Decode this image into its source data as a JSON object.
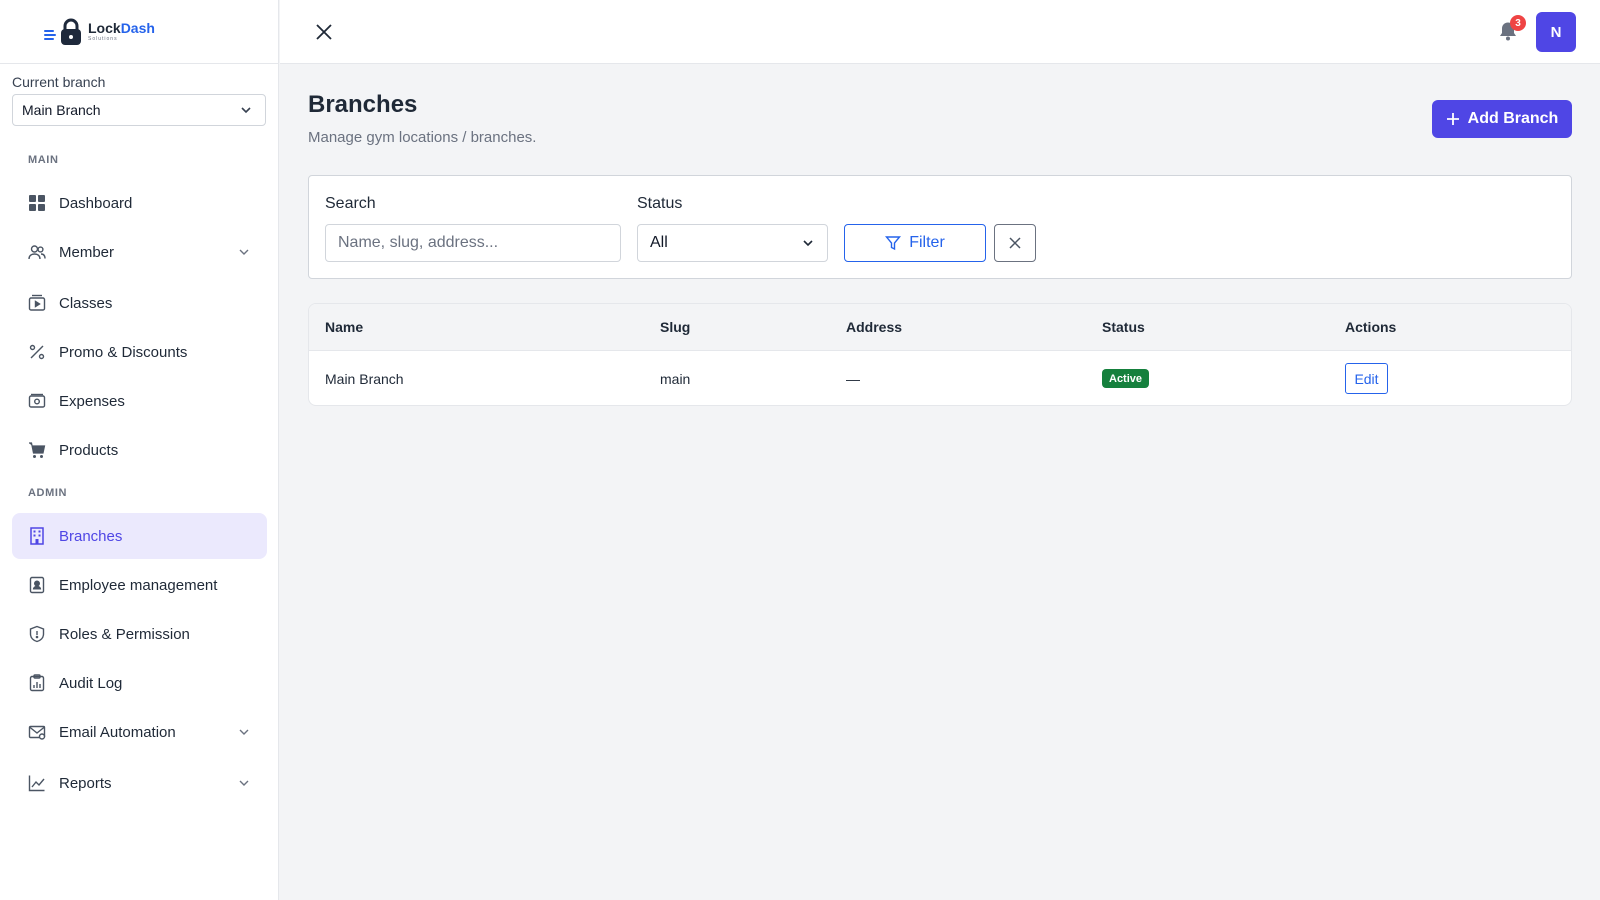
{
  "app": {
    "logo_name_part1": "Lock",
    "logo_name_part2": "Dash",
    "logo_subtitle": "Solutions"
  },
  "sidebar": {
    "branch_label": "Current branch",
    "branch_value": "Main Branch",
    "sections": {
      "main": "MAIN",
      "admin": "ADMIN"
    },
    "items": [
      {
        "label": "Dashboard",
        "icon": "grid-icon"
      },
      {
        "label": "Member",
        "icon": "users-icon",
        "expandable": true
      },
      {
        "label": "Classes",
        "icon": "video-icon"
      },
      {
        "label": "Promo & Discounts",
        "icon": "percent-icon"
      },
      {
        "label": "Expenses",
        "icon": "wallet-icon"
      },
      {
        "label": "Products",
        "icon": "cart-icon"
      },
      {
        "label": "Branches",
        "icon": "building-icon",
        "active": true
      },
      {
        "label": "Employee management",
        "icon": "id-badge-icon"
      },
      {
        "label": "Roles & Permission",
        "icon": "shield-icon"
      },
      {
        "label": "Audit Log",
        "icon": "clipboard-chart-icon"
      },
      {
        "label": "Email Automation",
        "icon": "mail-icon",
        "expandable": true
      },
      {
        "label": "Reports",
        "icon": "line-chart-icon",
        "expandable": true
      }
    ]
  },
  "topbar": {
    "notification_count": "3",
    "avatar_initial": "N"
  },
  "page": {
    "title": "Branches",
    "subtitle": "Manage gym locations / branches.",
    "add_button": "Add Branch"
  },
  "filters": {
    "search_label": "Search",
    "search_placeholder": "Name, slug, address...",
    "status_label": "Status",
    "status_value": "All",
    "filter_button": "Filter"
  },
  "table": {
    "columns": [
      "Name",
      "Slug",
      "Address",
      "Status",
      "Actions"
    ],
    "rows": [
      {
        "name": "Main Branch",
        "slug": "main",
        "address": "—",
        "status": "Active",
        "action": "Edit"
      }
    ]
  },
  "colors": {
    "primary": "#4f46e5",
    "link": "#2563eb",
    "success": "#15803d",
    "danger": "#ef4444"
  }
}
